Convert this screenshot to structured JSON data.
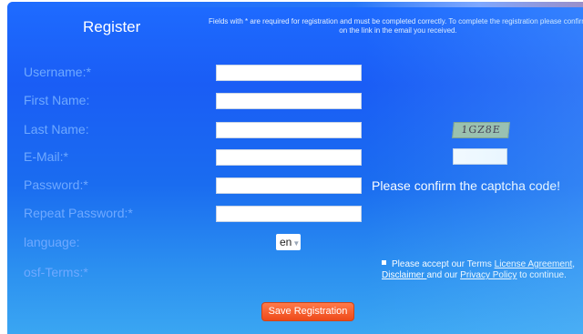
{
  "form": {
    "title": "Register",
    "notice": "Fields with * are required for registration and must be completed correctly. To complete the registration please confirm on the link in the email you received.",
    "fields": [
      {
        "label": "Username:*",
        "value": ""
      },
      {
        "label": "First Name:",
        "value": ""
      },
      {
        "label": "Last Name:",
        "value": ""
      },
      {
        "label": "E-Mail:*",
        "value": ""
      },
      {
        "label": "Password:*",
        "value": ""
      },
      {
        "label": "Repeat Password:*",
        "value": ""
      }
    ],
    "language": {
      "label": "language:",
      "selected": "en"
    },
    "terms": {
      "label": "osf-Terms:*",
      "text_1": "Please accept our Terms ",
      "link_license": "License Agreement",
      "sep": ", ",
      "link_disclaimer": "Disclaimer ",
      "text_2": "and our ",
      "link_privacy": "Privacy Policy",
      "text_3": " to continue."
    },
    "captcha": {
      "code": "1GZ8E",
      "message": "Please confirm the captcha code!",
      "value": ""
    },
    "save_label": "Save Registration"
  },
  "colors": {
    "background": "#1a5df5",
    "label": "#6fa9ff",
    "button": "#ee4a1a"
  }
}
